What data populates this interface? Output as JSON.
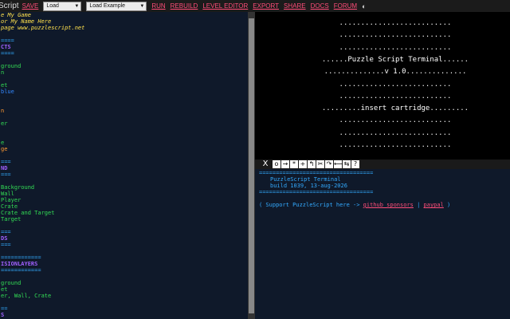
{
  "toolbar": {
    "title": "Script",
    "save": "SAVE",
    "load_select": "Load",
    "example_select": "Load Example",
    "run": "RUN",
    "rebuild": "REBUILD",
    "level_editor": "LEVEL EDITOR",
    "export": "EXPORT",
    "share": "SHARE",
    "docs": "DOCS",
    "forum": "FORUM"
  },
  "editor_lines": [
    {
      "text": "e My Game",
      "cls": "c-comment"
    },
    {
      "text": "or My Name Here",
      "cls": "c-comment"
    },
    {
      "text": "page www.puzzlescript.net",
      "cls": "c-comment"
    },
    {
      "text": "",
      "cls": ""
    },
    {
      "text": "====",
      "cls": "c-sep"
    },
    {
      "text": "CTS",
      "cls": "c-purple"
    },
    {
      "text": "====",
      "cls": "c-sep"
    },
    {
      "text": "",
      "cls": ""
    },
    {
      "text": "ground",
      "cls": "c-green"
    },
    {
      "text": "n",
      "cls": "c-green"
    },
    {
      "text": "",
      "cls": ""
    },
    {
      "text": "et",
      "cls": "c-green"
    },
    {
      "text": "blue",
      "cls": "c-blue"
    },
    {
      "text": "",
      "cls": ""
    },
    {
      "text": "",
      "cls": ""
    },
    {
      "text": "n",
      "cls": "c-orange"
    },
    {
      "text": "",
      "cls": ""
    },
    {
      "text": "er",
      "cls": "c-green"
    },
    {
      "text": "",
      "cls": ""
    },
    {
      "text": "",
      "cls": ""
    },
    {
      "text": "e",
      "cls": "c-green"
    },
    {
      "text": "ge",
      "cls": "c-orange"
    },
    {
      "text": "",
      "cls": ""
    },
    {
      "text": "===",
      "cls": "c-sep"
    },
    {
      "text": "ND",
      "cls": "c-purple"
    },
    {
      "text": "===",
      "cls": "c-sep"
    },
    {
      "text": "",
      "cls": ""
    },
    {
      "text": "Background",
      "cls": "c-green"
    },
    {
      "text": "Wall",
      "cls": "c-green"
    },
    {
      "text": "Player",
      "cls": "c-green"
    },
    {
      "text": "Crate",
      "cls": "c-green"
    },
    {
      "text": "Crate and Target",
      "cls": "c-green"
    },
    {
      "text": "Target",
      "cls": "c-green"
    },
    {
      "text": "",
      "cls": ""
    },
    {
      "text": "===",
      "cls": "c-sep"
    },
    {
      "text": "DS",
      "cls": "c-purple"
    },
    {
      "text": "===",
      "cls": "c-sep"
    },
    {
      "text": "",
      "cls": ""
    },
    {
      "text": "============",
      "cls": "c-sep"
    },
    {
      "text": "ISIONLAYERS",
      "cls": "c-purple"
    },
    {
      "text": "============",
      "cls": "c-sep"
    },
    {
      "text": "",
      "cls": ""
    },
    {
      "text": "ground",
      "cls": "c-green"
    },
    {
      "text": "et",
      "cls": "c-green"
    },
    {
      "text": "er, Wall, Crate",
      "cls": "c-green"
    },
    {
      "text": "",
      "cls": ""
    },
    {
      "text": "==",
      "cls": "c-sep"
    },
    {
      "text": "S",
      "cls": "c-purple"
    }
  ],
  "game_lines": [
    "..........................",
    "..........................",
    "..........................",
    "......Puzzle Script Terminal......",
    "..............v 1.0..............",
    "..........................",
    "..........................",
    ".........insert cartridge.........",
    "..........................",
    "..........................",
    ".........................."
  ],
  "console_buttons": [
    "X",
    "o",
    "→",
    "*",
    "+",
    "↰",
    "✂",
    "↷",
    "⟵",
    "⇆",
    "?"
  ],
  "console": {
    "sep1": "==================================",
    "name": "PuzzleScript Terminal",
    "build": "build 1039, 13-aug-2026",
    "sep2": "==================================",
    "support_prefix": "( Support PuzzleScript here -> ",
    "sponsors": "github sponsors",
    "pipe": " | ",
    "paypal": "paypal",
    "support_suffix": " )"
  }
}
